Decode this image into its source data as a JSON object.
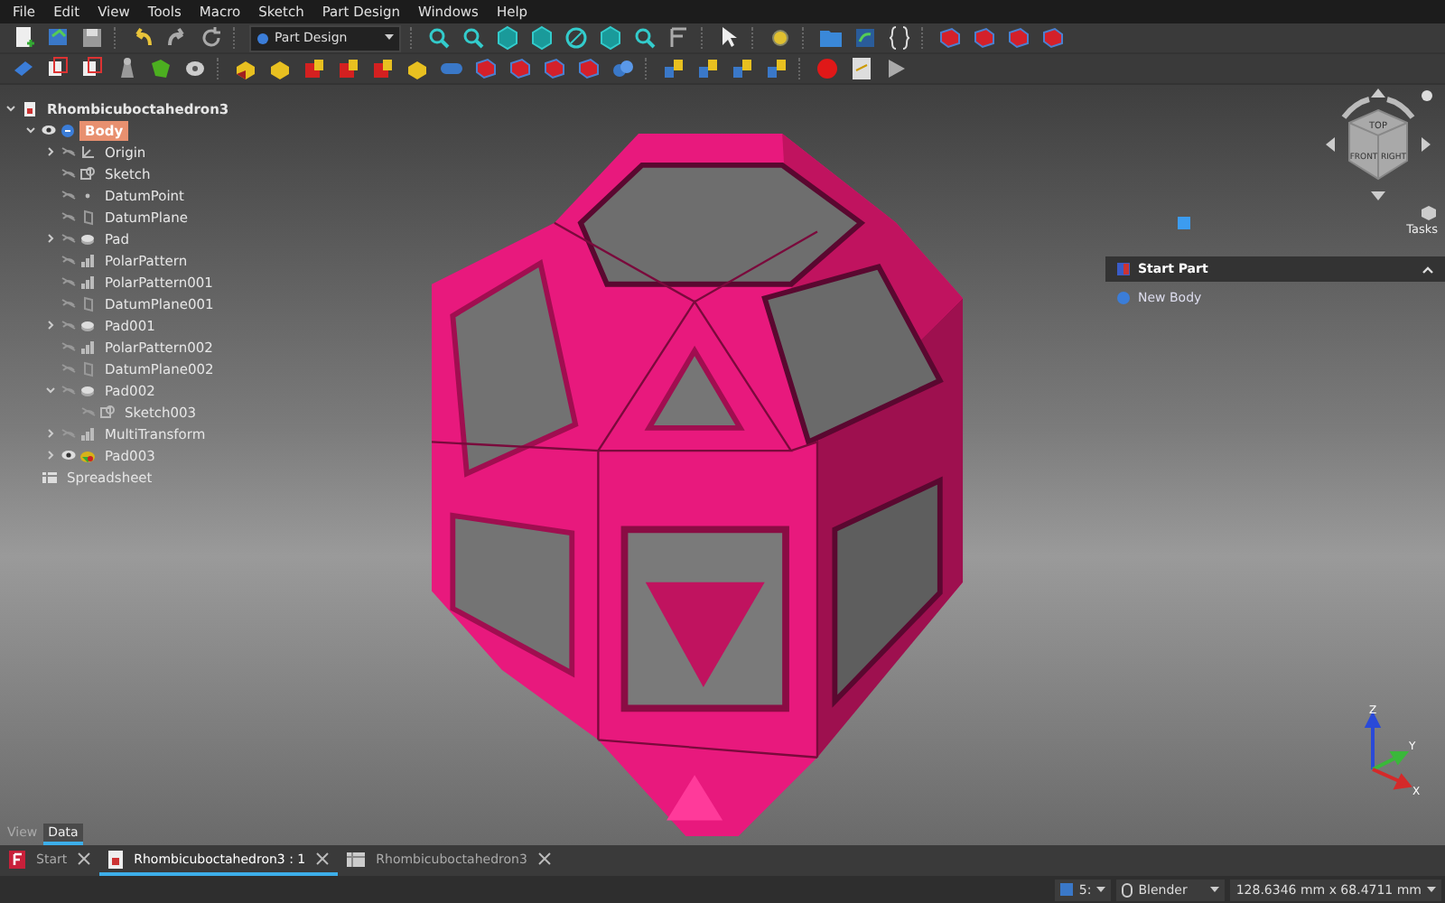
{
  "menu_bar": [
    "File",
    "Edit",
    "View",
    "Tools",
    "Macro",
    "Sketch",
    "Part Design",
    "Windows",
    "Help"
  ],
  "toolbar": {
    "workbench": "Part Design"
  },
  "tree": [
    {
      "label": "Rhombicuboctahedron3",
      "kind": "document",
      "selected": false,
      "expanded": true,
      "children": [
        {
          "label": "Body",
          "kind": "body",
          "selected": true,
          "visible": true,
          "expanded": true,
          "children": [
            {
              "label": "Origin",
              "kind": "origin",
              "selected": false,
              "visible": false,
              "expanded": false
            },
            {
              "label": "Sketch",
              "kind": "sketch",
              "selected": false,
              "visible": false
            },
            {
              "label": "DatumPoint",
              "kind": "point",
              "selected": false,
              "visible": false
            },
            {
              "label": "DatumPlane",
              "kind": "plane",
              "selected": false,
              "visible": false
            },
            {
              "label": "Pad",
              "kind": "pad",
              "selected": false,
              "visible": false,
              "expanded": false
            },
            {
              "label": "PolarPattern",
              "kind": "pattern",
              "selected": false,
              "visible": false
            },
            {
              "label": "PolarPattern001",
              "kind": "pattern",
              "selected": false,
              "visible": false
            },
            {
              "label": "DatumPlane001",
              "kind": "plane",
              "selected": false,
              "visible": false
            },
            {
              "label": "Pad001",
              "kind": "pad",
              "selected": false,
              "visible": false,
              "expanded": false
            },
            {
              "label": "PolarPattern002",
              "kind": "pattern",
              "selected": false,
              "visible": false
            },
            {
              "label": "DatumPlane002",
              "kind": "plane",
              "selected": false,
              "visible": false
            },
            {
              "label": "Pad002",
              "kind": "pad",
              "selected": false,
              "visible": false,
              "expanded": true,
              "children": [
                {
                  "label": "Sketch003",
                  "kind": "sketch",
                  "selected": false,
                  "visible": false
                }
              ]
            },
            {
              "label": "MultiTransform",
              "kind": "pattern",
              "selected": false,
              "visible": false,
              "expanded": false
            },
            {
              "label": "Pad003",
              "kind": "tip",
              "selected": false,
              "visible": true,
              "expanded": false
            }
          ]
        },
        {
          "label": "Spreadsheet",
          "kind": "spreadsheet",
          "selected": false
        }
      ]
    }
  ],
  "panel_tabs": [
    {
      "label": "View",
      "selected": false
    },
    {
      "label": "Data",
      "selected": true
    }
  ],
  "navcube": {
    "faces": [
      "TOP",
      "FRONT",
      "RIGHT"
    ],
    "label": "Tasks"
  },
  "task_panel": {
    "title": "Start Part",
    "expanded": true,
    "items": [
      "New Body"
    ]
  },
  "axes": [
    "Z",
    "Y",
    "X"
  ],
  "document_tabs": [
    {
      "label": "Start",
      "kind": "start",
      "selected": false
    },
    {
      "label": "Rhombicuboctahedron3 : 1",
      "kind": "view",
      "selected": true
    },
    {
      "label": "Rhombicuboctahedron3",
      "kind": "sheet",
      "selected": false
    }
  ],
  "status_bar": {
    "draw_style": "5:",
    "navigation": "Blender",
    "dimensions": "128.6346 mm x 68.4711 mm"
  }
}
